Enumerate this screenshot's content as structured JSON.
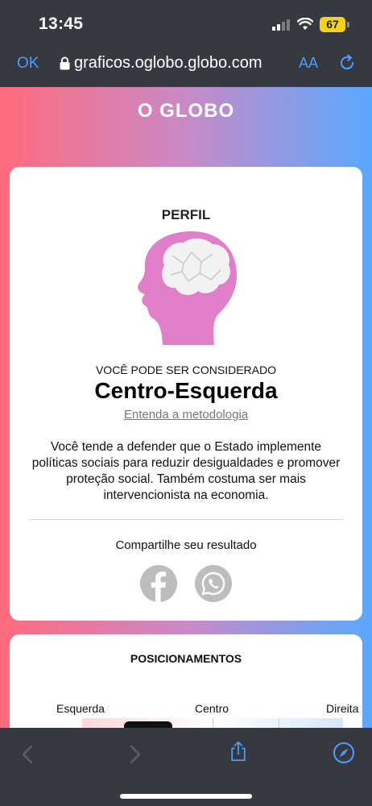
{
  "status_bar": {
    "time": "13:45",
    "battery": "67"
  },
  "browser": {
    "done_label": "OK",
    "url": "graficos.oglobo.globo.com",
    "text_size_label": "AA"
  },
  "brand": {
    "name": "O GLOBO"
  },
  "profile": {
    "title": "PERFIL",
    "considered_label": "VOCÊ PODE SER CONSIDERADO",
    "result": "Centro-Esquerda",
    "methodology_link": "Entenda a metodologia",
    "description": "Você tende a defender que o Estado implemente políticas sociais para reduzir desigualdades e promover proteção social. Também costuma ser mais intervencionista na economia.",
    "share_label": "Compartilhe seu resultado",
    "share_icons": [
      "facebook-icon",
      "whatsapp-icon"
    ]
  },
  "positions": {
    "title": "POSICIONAMENTOS",
    "scale_labels": {
      "left": "Esquerda",
      "center": "Centro",
      "right": "Direita"
    }
  },
  "colors": {
    "accent": "#4a9fff",
    "chrome": "#36393f",
    "head": "#e07fc8",
    "share_gray": "#bdbdbd"
  },
  "bottom_toolbar": {
    "icons": [
      "back-icon",
      "forward-icon",
      "share-icon",
      "compass-icon"
    ]
  }
}
